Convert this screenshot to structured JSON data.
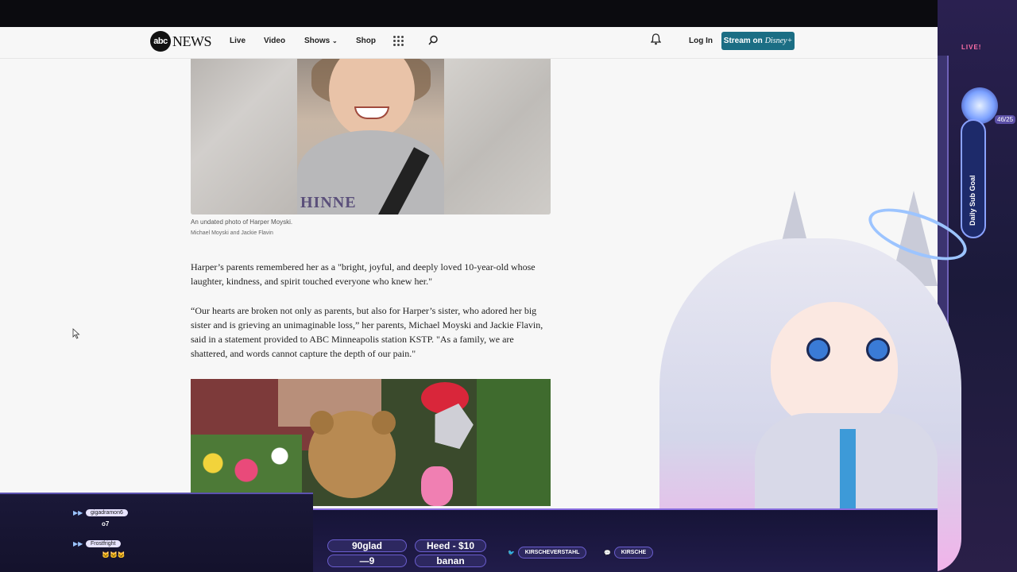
{
  "nav": {
    "logo_abc": "abc",
    "logo_news": "NEWS",
    "links": [
      "Live",
      "Video",
      "Shows",
      "Shop"
    ],
    "login": "Log In",
    "stream_label": "Stream on",
    "stream_brand": "Disney+"
  },
  "article": {
    "photo1_caption": "An undated photo of Harper Moyski.",
    "photo1_credit": "Michael Moyski and Jackie Flavin",
    "photo1_shirt_text": "HINNE",
    "para1": "Harper’s parents remembered her as a \"bright, joyful, and deeply loved 10-year-old whose laughter, kindness, and spirit touched everyone who knew her.\"",
    "para2": "“Our hearts are broken not only as parents, but also for Harper’s sister, who adored her big sister and is grieving an unimaginable loss,” her parents, Michael Moyski and Jackie Flavin, said in a statement provided to ABC Minneapolis station KSTP. \"As a family, we are shattered, and words cannot capture the depth of our pain.\""
  },
  "overlay": {
    "live_badge": "LIVE!",
    "goal_label": "Daily Sub Goal",
    "goal_count": "46/25",
    "chat": [
      {
        "user": "gigadramon6",
        "message": "o7"
      },
      {
        "user": "Frostfright",
        "message": "🐱🐱🐱"
      }
    ],
    "ticker": {
      "item1": "90glad",
      "item2": "Heed - $10",
      "item3": "banan",
      "item4": "—9"
    },
    "socials": {
      "twitter": "KIRSCHEVERSTAHL",
      "chat": "KIRSCHE"
    }
  }
}
